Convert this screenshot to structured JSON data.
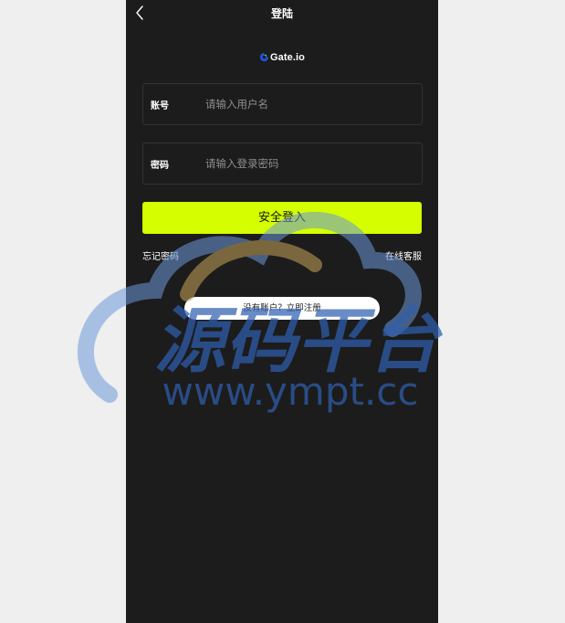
{
  "nav": {
    "title": "登陆",
    "back_icon": "chevron-left-icon"
  },
  "logo": {
    "text": "Gate.io",
    "mark_colors": [
      "#2354e6",
      "#17e5a8"
    ]
  },
  "form": {
    "account": {
      "label": "账号",
      "placeholder": "请输入用户名"
    },
    "password": {
      "label": "密码",
      "placeholder": "请输入登录密码"
    },
    "submit_label": "安全登入"
  },
  "links": {
    "forgot_password": "忘记密码",
    "online_service": "在线客服"
  },
  "register_label": "没有账户？立即注册",
  "watermark": {
    "title": "源码平台",
    "url": "www.ympt.cc"
  },
  "colors": {
    "background": "#1c1c1c",
    "accent": "#d5fe00",
    "page": "#efefef"
  }
}
